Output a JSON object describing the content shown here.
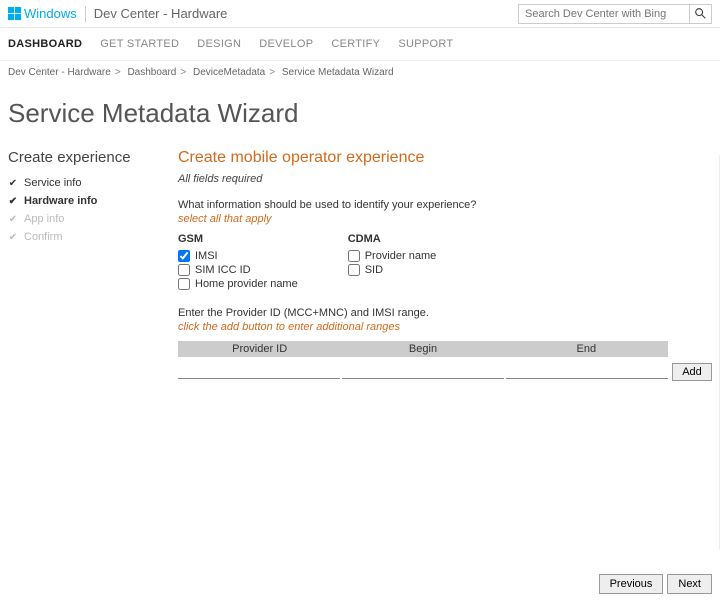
{
  "header": {
    "logo_text": "Windows",
    "site_title": "Dev Center - Hardware",
    "search_placeholder": "Search Dev Center with Bing"
  },
  "nav": {
    "items": [
      "DASHBOARD",
      "GET STARTED",
      "DESIGN",
      "DEVELOP",
      "CERTIFY",
      "SUPPORT"
    ],
    "active_index": 0
  },
  "breadcrumb": [
    "Dev Center - Hardware",
    "Dashboard",
    "DeviceMetadata",
    "Service Metadata Wizard"
  ],
  "page_title": "Service Metadata Wizard",
  "sidebar": {
    "heading": "Create experience",
    "steps": [
      {
        "label": "Service info",
        "state": "done"
      },
      {
        "label": "Hardware info",
        "state": "current"
      },
      {
        "label": "App info",
        "state": "pending"
      },
      {
        "label": "Confirm",
        "state": "pending"
      }
    ]
  },
  "main": {
    "heading": "Create mobile operator experience",
    "required_note": "All fields required",
    "question": "What information should be used to identify your experience?",
    "select_hint": "select all that apply",
    "gsm": {
      "title": "GSM",
      "options": [
        {
          "label": "IMSI",
          "checked": true
        },
        {
          "label": "SIM ICC ID",
          "checked": false
        },
        {
          "label": "Home provider name",
          "checked": false
        }
      ]
    },
    "cdma": {
      "title": "CDMA",
      "options": [
        {
          "label": "Provider name",
          "checked": false
        },
        {
          "label": "SID",
          "checked": false
        }
      ]
    },
    "provider_instruction": "Enter the Provider ID (MCC+MNC) and IMSI range.",
    "provider_hint": "click the add button to enter additional ranges",
    "table_headers": [
      "Provider ID",
      "Begin",
      "End"
    ],
    "add_label": "Add"
  },
  "footer": {
    "previous": "Previous",
    "next": "Next"
  }
}
